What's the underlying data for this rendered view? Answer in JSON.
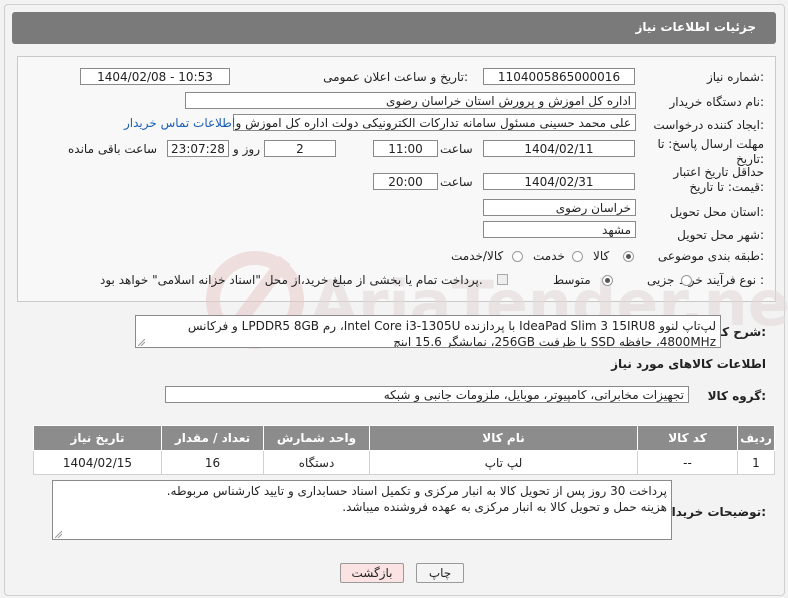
{
  "header": {
    "title": "جزئیات اطلاعات نیاز"
  },
  "form": {
    "need_number_label": "شماره نیاز:",
    "need_number": "1104005865000016",
    "announce_label": "تاریخ و ساعت اعلان عمومی:",
    "announce_value": "1404/02/08 - 10:53",
    "buyer_org_label": "نام دستگاه خریدار:",
    "buyer_org": "اداره کل اموزش و پرورش استان خراسان رضوی",
    "creator_label": "ایجاد کننده درخواست:",
    "creator": "علی محمد حسینی مسئول سامانه تدارکات الکترونیکی دولت اداره کل اموزش و",
    "contact_link": "اطلاعات تماس خریدار",
    "deadline_label": "مهلت ارسال پاسخ: تا تاریخ:",
    "deadline_date": "1404/02/11",
    "time_label": "ساعت",
    "deadline_time": "11:00",
    "days_value": "2",
    "day_and_label": "روز و",
    "remaining_value": "23:07:28",
    "remaining_label": "ساعت باقی مانده",
    "price_validity_label": "حداقل تاریخ اعتبار قیمت: تا تاریخ:",
    "price_date": "1404/02/31",
    "price_time": "20:00",
    "province_label": "استان محل تحویل:",
    "province": "خراسان رضوی",
    "city_label": "شهر محل تحویل:",
    "city": "مشهد",
    "category_label": "طبقه بندی موضوعی:",
    "category_options": [
      "کالا",
      "خدمت",
      "کالا/خدمت"
    ],
    "process_label": "نوع فرآیند خرید :",
    "process_options": [
      "جزیی",
      "متوسط"
    ],
    "payment_note": "پرداخت تمام یا بخشی از مبلغ خرید،از محل \"اسناد خزانه اسلامی\" خواهد بود."
  },
  "description": {
    "label": "شرح کلی نیاز:",
    "text": "لپ‌تاپ لنوو IdeaPad Slim 3 15IRU8 با پردازنده Intel Core i3-1305U، رم LPDDR5 8GB و فرکانس 4800MHz، حافظه SSD با ظرفیت 256GB، نمایشگر 15.6 اینچ"
  },
  "goods": {
    "section_title": "اطلاعات کالاهای مورد نیاز",
    "group_label": "گروه کالا:",
    "group_value": "تجهیزات مخابراتی، کامپیوتر، موبایل، ملزومات جانبی و شبکه",
    "columns": [
      "ردیف",
      "کد کالا",
      "نام کالا",
      "واحد شمارش",
      "تعداد / مقدار",
      "تاریخ نیاز"
    ],
    "rows": [
      [
        "1",
        "--",
        "لپ تاپ",
        "دستگاه",
        "16",
        "1404/02/15"
      ]
    ]
  },
  "buyer_notes": {
    "label": "توضیحات خریدار:",
    "line1": "پرداخت 30 روز پس از تحویل کالا به انبار مرکزی و تکمیل اسناد حسابداری و تایید کارشناس مربوطه.",
    "line2": "هزینه حمل و تحویل کالا به انبار مرکزی به عهده فروشنده میباشد."
  },
  "buttons": {
    "print": "چاپ",
    "back": "بازگشت"
  },
  "colors": {
    "header_bg": "#7a7a7a",
    "table_header_bg": "#8c8c8c",
    "back_button_bg": "#fbe3e3",
    "link": "#1a5fb4"
  }
}
